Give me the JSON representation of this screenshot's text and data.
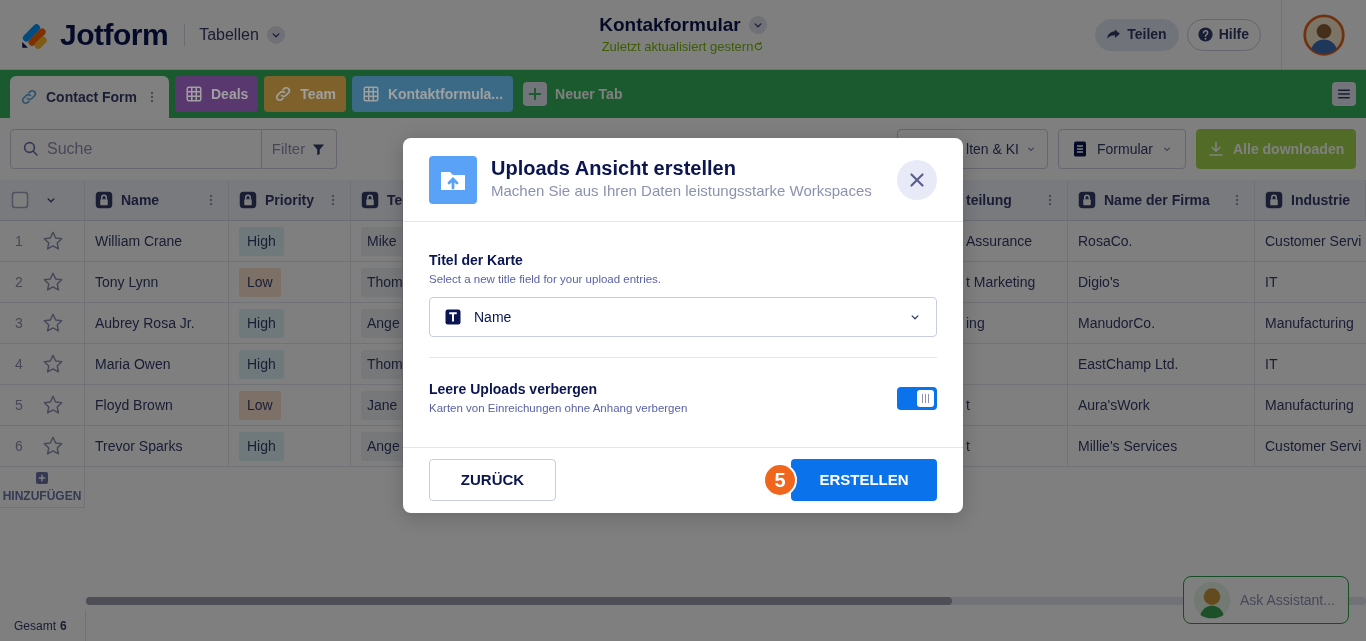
{
  "app": {
    "logo": "Jotform",
    "section": "Tabellen"
  },
  "document": {
    "title": "Kontakformular",
    "status": "Zuletzt aktualisiert gestern"
  },
  "header_buttons": [
    {
      "label": "Teilen",
      "kind": "share"
    },
    {
      "label": "Hilfe",
      "kind": "help"
    }
  ],
  "tabs": [
    {
      "label": "Contact Form",
      "kind": "form",
      "color": "#2d5470",
      "selected": true
    },
    {
      "label": "Deals",
      "kind": "table",
      "color": "#58386e",
      "selected": false
    },
    {
      "label": "Team",
      "kind": "form",
      "color": "#7f622b",
      "selected": false
    },
    {
      "label": "Kontaktformula...",
      "kind": "table",
      "color": "#3b6a86",
      "selected": false
    }
  ],
  "new_tab": "Neuer Tab",
  "toolbar": {
    "search_placeholder": "Suche",
    "filter": "Filter",
    "buttons": [
      {
        "label": "lten & KI",
        "kind": "dropdown"
      },
      {
        "label": "Formular",
        "kind": "form-dropdown"
      },
      {
        "label": "Alle downloaden",
        "kind": "download"
      }
    ]
  },
  "table": {
    "select_all_checked": false,
    "columns": [
      {
        "label": "Name",
        "locked": true,
        "menu": true
      },
      {
        "label": "Priority",
        "locked": true,
        "menu": true
      },
      {
        "label": "Te",
        "locked": true,
        "menu": false
      },
      {
        "label": "teilung",
        "locked": false,
        "menu": true
      },
      {
        "label": "Name der Firma",
        "locked": true,
        "menu": true
      },
      {
        "label": "Industrie",
        "locked": true,
        "menu": false
      }
    ],
    "rows": [
      {
        "number": "1",
        "starred": false,
        "name": "William Crane",
        "priority": {
          "text": "High",
          "color": "#6f797c"
        },
        "team": "Mike",
        "department": "Assurance",
        "company": "RosaCo.",
        "industry": "Customer Servi"
      },
      {
        "number": "2",
        "starred": false,
        "name": "Tony Lynn",
        "priority": {
          "text": "Low",
          "color": "#7d7067"
        },
        "team": "Thom",
        "department": "t Marketing",
        "company": "Digio's",
        "industry": "IT"
      },
      {
        "number": "3",
        "starred": false,
        "name": "Aubrey Rosa Jr.",
        "priority": {
          "text": "High",
          "color": "#6f797c"
        },
        "team": "Ange",
        "department": "ing",
        "company": "ManudorCo.",
        "industry": "Manufacturing"
      },
      {
        "number": "4",
        "starred": false,
        "name": "Maria Owen",
        "priority": {
          "text": "High",
          "color": "#6f797c"
        },
        "team": "Thom",
        "company": "EastChamp Ltd.",
        "industry": "IT"
      },
      {
        "number": "5",
        "starred": false,
        "name": "Floyd Brown",
        "priority": {
          "text": "Low",
          "color": "#7d7067"
        },
        "team": "Jane",
        "department": "t",
        "company": "Aura'sWork",
        "industry": "Manufacturing"
      },
      {
        "number": "6",
        "starred": false,
        "name": "Trevor Sparks",
        "priority": {
          "text": "High",
          "color": "#6f797c"
        },
        "team": "Ange",
        "department": "t",
        "company": "Millie's Services",
        "industry": "Customer Servi"
      }
    ],
    "add_label": "HINZUFÜGEN"
  },
  "footer": {
    "total_label": "Gesamt",
    "total": "6"
  },
  "assistant": "Ask Assistant...",
  "modal": {
    "title": "Uploads Ansicht erstellen",
    "subtitle": "Machen Sie aus Ihren Daten leistungsstarke Workspaces",
    "field_label": "Titel der Karte",
    "field_help": "Select a new title field for your upload entries.",
    "select_value": "Name",
    "toggle": {
      "label": "Leere Uploads verbergen",
      "help": "Karten von Einreichungen ohne Anhang verbergen",
      "on": true
    },
    "buttons": [
      {
        "label": "ZURÜCK",
        "kind": "secondary"
      },
      {
        "label": "ERSTELLEN",
        "kind": "primary",
        "step": "5"
      }
    ]
  }
}
